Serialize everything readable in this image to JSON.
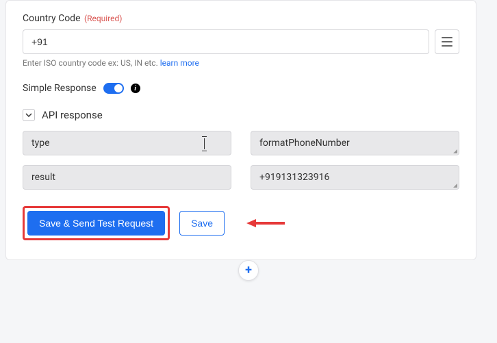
{
  "country_code": {
    "label": "Country Code",
    "required_text": "(Required)",
    "value": "+91",
    "helper": "Enter ISO country code ex: US, IN etc.",
    "learn_more": "learn more"
  },
  "simple_response": {
    "label": "Simple Response"
  },
  "api_response": {
    "label": "API response",
    "rows": [
      {
        "key": "type",
        "value": "formatPhoneNumber"
      },
      {
        "key": "result",
        "value": "+919131323916"
      }
    ]
  },
  "buttons": {
    "save_send": "Save & Send Test Request",
    "save": "Save"
  }
}
